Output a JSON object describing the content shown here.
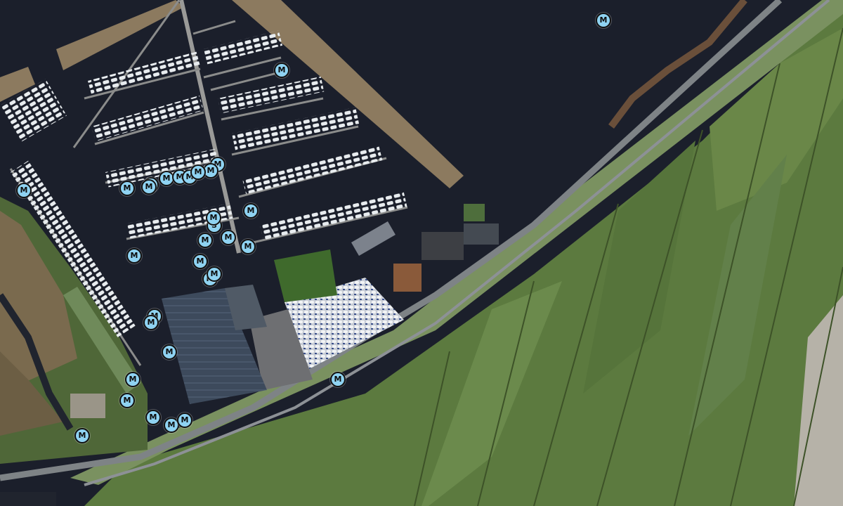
{
  "map": {
    "view": "satellite",
    "colors": {
      "water": "#1b1f2b",
      "field": "#5b7a3e",
      "marker_fill": "#8fd3f2",
      "marker_border": "#111111"
    },
    "marker_types": {
      "M": "mooring",
      "S": "service"
    },
    "markers": [
      {
        "label": "M"
      },
      {
        "label": "M"
      },
      {
        "label": "M"
      },
      {
        "label": "M"
      },
      {
        "label": "S"
      },
      {
        "label": "M"
      },
      {
        "label": "M"
      },
      {
        "label": "M"
      },
      {
        "label": "M"
      },
      {
        "label": "M"
      },
      {
        "label": "M"
      },
      {
        "label": "M"
      },
      {
        "label": "M"
      },
      {
        "label": "S"
      },
      {
        "label": "M"
      },
      {
        "label": "M"
      },
      {
        "label": "M"
      },
      {
        "label": "M"
      },
      {
        "label": "M"
      },
      {
        "label": "M"
      },
      {
        "label": "M"
      },
      {
        "label": "M"
      },
      {
        "label": "M"
      },
      {
        "label": "M"
      },
      {
        "label": "M"
      },
      {
        "label": "M"
      },
      {
        "label": "M"
      },
      {
        "label": "M"
      },
      {
        "label": "M"
      },
      {
        "label": "M"
      },
      {
        "label": "M"
      },
      {
        "label": "M"
      }
    ]
  }
}
